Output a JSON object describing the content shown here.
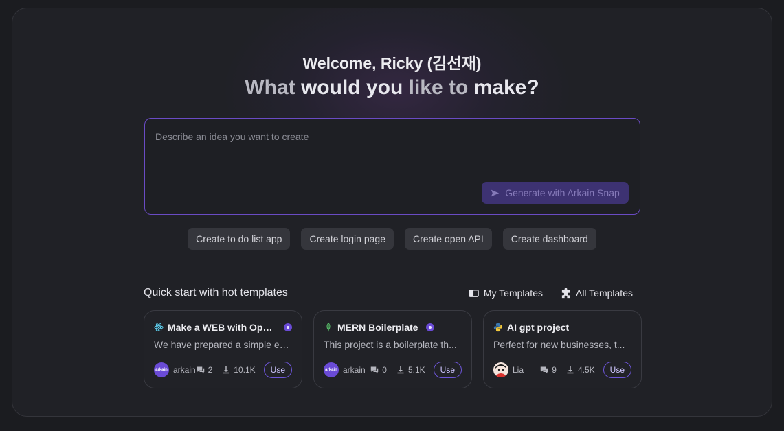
{
  "greeting": "Welcome, Ricky (김선재)",
  "headline": {
    "part1": "What ",
    "strong1": "would you",
    "part2": " like to ",
    "strong2": "make?"
  },
  "prompt": {
    "placeholder": "Describe an idea you want to create",
    "generate_label": "Generate with Arkain Snap"
  },
  "suggestions": [
    "Create to do list app",
    "Create login page",
    "Create open API",
    "Create dashboard"
  ],
  "templates": {
    "section_title": "Quick start with hot templates",
    "my_templates_label": "My Templates",
    "all_templates_label": "All Templates",
    "use_label": "Use",
    "cards": [
      {
        "icon": "react-icon",
        "title": "Make a WEB with Ope...",
        "description": "We have prepared a simple ex...",
        "author": "arkain",
        "avatar_text": "arkain",
        "comments": "2",
        "downloads": "10.1K"
      },
      {
        "icon": "mern-icon",
        "title": "MERN Boilerplate",
        "description": "This project is a boilerplate th...",
        "author": "arkain",
        "avatar_text": "arkain",
        "comments": "0",
        "downloads": "5.1K"
      },
      {
        "icon": "python-icon",
        "title": "AI gpt project",
        "description": "Perfect for new businesses, t...",
        "author": "Lia",
        "avatar_text": "",
        "comments": "9",
        "downloads": "4.5K"
      }
    ]
  },
  "colors": {
    "accent": "#6a4bd6",
    "background": "#202126",
    "border_focus": "#6a4bc4"
  }
}
